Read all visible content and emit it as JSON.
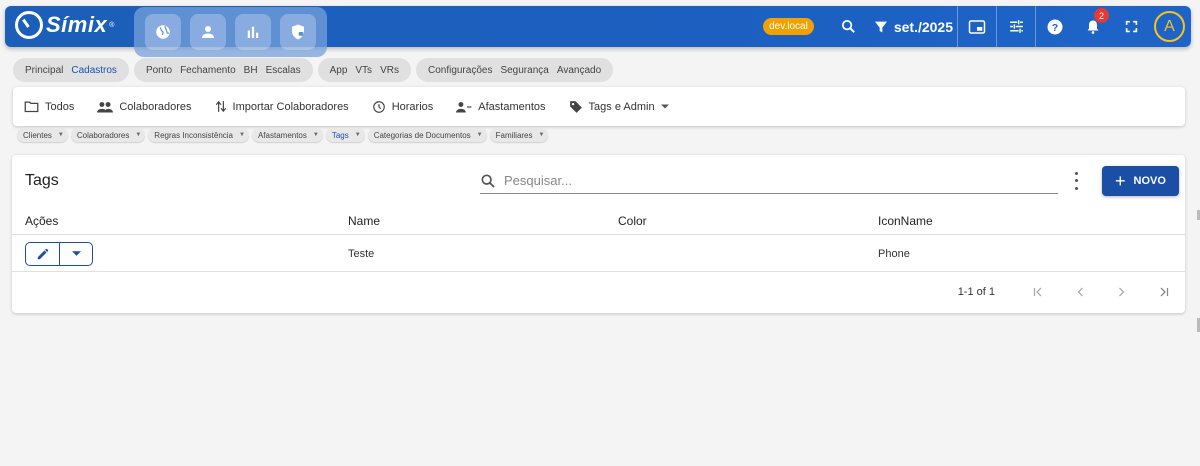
{
  "app": {
    "name": "Símix"
  },
  "topbar": {
    "env_badge": "dev.local",
    "period": "set./2025",
    "notifications_count": "2",
    "avatar_initial": "A"
  },
  "nav_groups": [
    {
      "items": [
        "Principal",
        "Cadastros"
      ],
      "active": "Cadastros"
    },
    {
      "items": [
        "Ponto",
        "Fechamento",
        "BH",
        "Escalas"
      ]
    },
    {
      "items": [
        "App",
        "VTs",
        "VRs"
      ]
    },
    {
      "items": [
        "Configurações",
        "Segurança",
        "Avançado"
      ]
    }
  ],
  "submenu": [
    {
      "label": "Todos",
      "icon": "folder-icon"
    },
    {
      "label": "Colaboradores",
      "icon": "people-icon"
    },
    {
      "label": "Importar Colaboradores",
      "icon": "import-arrows-icon"
    },
    {
      "label": "Horarios",
      "icon": "clock-icon"
    },
    {
      "label": "Afastamentos",
      "icon": "person-remove-icon"
    },
    {
      "label": "Tags e Admin",
      "icon": "tag-icon"
    }
  ],
  "breadcrumbs": [
    "Clientes",
    "Colaboradores",
    "Regras Inconsistência",
    "Afastamentos",
    "Tags",
    "Categorias de Documentos",
    "Familiares"
  ],
  "breadcrumbs_active": "Tags",
  "card": {
    "title": "Tags",
    "search_placeholder": "Pesquisar...",
    "new_label": "NOVO",
    "columns": [
      "Ações",
      "Name",
      "Color",
      "IconName"
    ],
    "rows": [
      {
        "name": "Teste",
        "color": "",
        "icon_name": "Phone"
      }
    ],
    "pagination": "1-1 of 1"
  },
  "colors": {
    "primary": "#1a4fa5",
    "topbar": "#1c5fc0",
    "env_badge": "#f2a100",
    "avatar": "#f6c21c"
  }
}
